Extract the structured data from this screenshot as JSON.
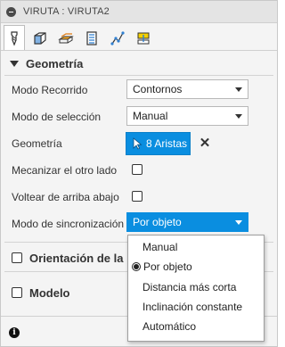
{
  "titlebar": {
    "title": "VIRUTA : VIRUTA2"
  },
  "tabs": [
    {
      "icon": "tool-icon",
      "active": true
    },
    {
      "icon": "stock-box-icon",
      "active": false
    },
    {
      "icon": "heights-icon",
      "active": false
    },
    {
      "icon": "passes-icon",
      "active": false
    },
    {
      "icon": "linking-icon",
      "active": false
    },
    {
      "icon": "shaft-icon",
      "active": false
    }
  ],
  "geometry_section": {
    "title": "Geometría",
    "modo_recorrido": {
      "label": "Modo Recorrido",
      "value": "Contornos"
    },
    "modo_seleccion": {
      "label": "Modo de selección",
      "value": "Manual"
    },
    "geometria": {
      "label": "Geometría",
      "button": "8 Aristas",
      "clear": "✕"
    },
    "mecanizar": {
      "label": "Mecanizar el otro lado",
      "checked": false
    },
    "voltear": {
      "label": "Voltear de arriba abajo",
      "checked": false
    },
    "modo_sincronizacion": {
      "label": "Modo de sincronización",
      "value": "Por objeto"
    }
  },
  "orientation_section": {
    "title": "Orientación de la he",
    "checked": false
  },
  "model_section": {
    "title": "Modelo",
    "checked": false
  },
  "sync_dropdown": {
    "options": [
      "Manual",
      "Por objeto",
      "Distancia más corta",
      "Inclinación constante",
      "Automático"
    ],
    "selected": "Por objeto"
  },
  "footer": {
    "info": "i"
  },
  "colors": {
    "accent": "#0a8ee0",
    "panel_bg": "#f4f4f4"
  }
}
